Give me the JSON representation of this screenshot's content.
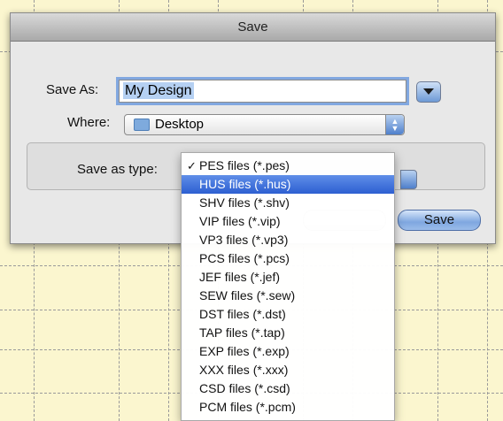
{
  "window": {
    "title": "Save"
  },
  "save_as": {
    "label": "Save As:",
    "value": "My Design"
  },
  "where": {
    "label": "Where:",
    "value": "Desktop"
  },
  "file_type": {
    "label": "Save as type:",
    "options": [
      "PES files (*.pes)",
      "HUS files (*.hus)",
      "SHV files (*.shv)",
      "VIP files (*.vip)",
      "VP3 files (*.vp3)",
      "PCS files (*.pcs)",
      "JEF files (*.jef)",
      "SEW files (*.sew)",
      "DST files (*.dst)",
      "TAP files (*.tap)",
      "EXP files (*.exp)",
      "XXX files (*.xxx)",
      "CSD files (*.csd)",
      "PCM files (*.pcm)"
    ],
    "checked_index": 0,
    "highlighted_index": 1,
    "check_mark": "✓"
  },
  "buttons": {
    "save": "Save"
  },
  "colors": {
    "accent": "#3a6ad6",
    "background": "#fbf6cf"
  }
}
